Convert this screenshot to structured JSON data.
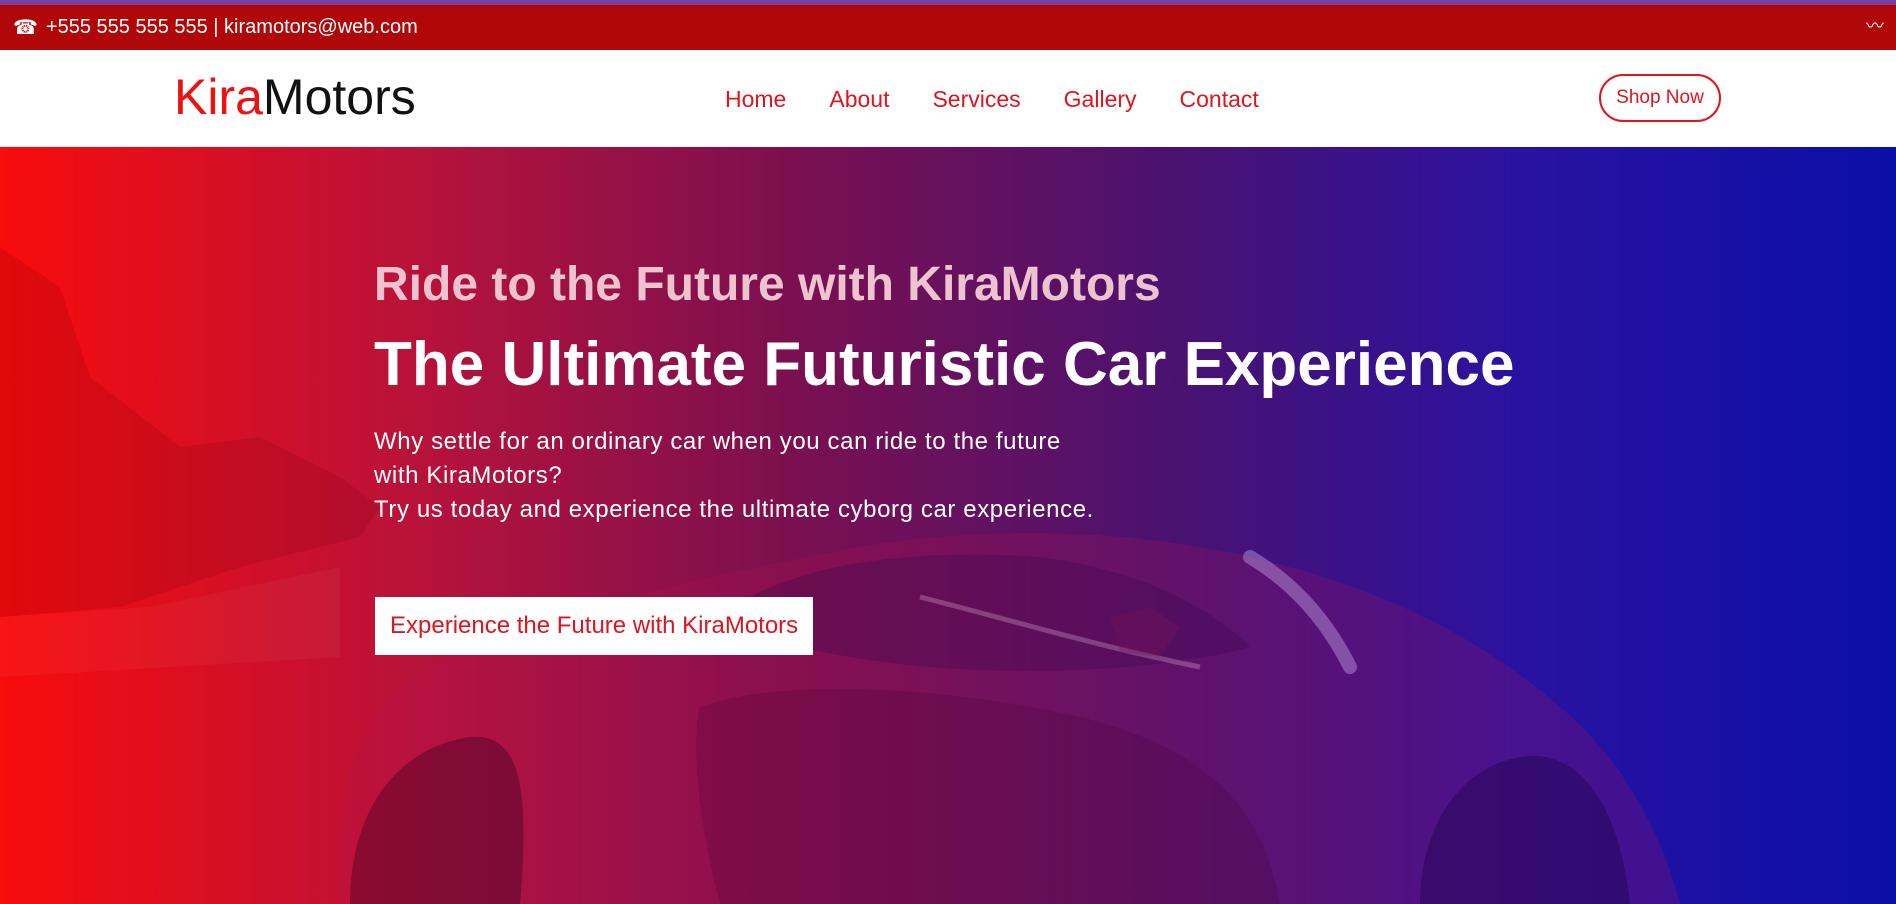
{
  "topbar": {
    "phone_icon": "☎",
    "contact": "+555 555 555 555 | kiramotors@web.com",
    "wave_icon": "〰"
  },
  "brand": {
    "part1": "Kira",
    "part2": "Motors",
    "color_part1": "#ee1111",
    "color_part2": "#111111"
  },
  "nav": {
    "items": [
      {
        "label": "Home"
      },
      {
        "label": "About"
      },
      {
        "label": "Services"
      },
      {
        "label": "Gallery"
      },
      {
        "label": "Contact"
      }
    ],
    "shop_button": "Shop Now"
  },
  "hero": {
    "subtitle": "Ride to the Future with KiraMotors",
    "title": "The Ultimate Futuristic Car Experience",
    "description_line1": "Why settle for an ordinary car when you can ride to the future with KiraMotors?",
    "description_line2": "Try us today and experience the ultimate cyborg car experience.",
    "cta": "Experience the Future with KiraMotors"
  },
  "colors": {
    "accent": "#e0141e",
    "topbar_bg": "#b00808",
    "hero_gradient_start": "#f80c0c",
    "hero_gradient_end": "#0a0fa8"
  }
}
